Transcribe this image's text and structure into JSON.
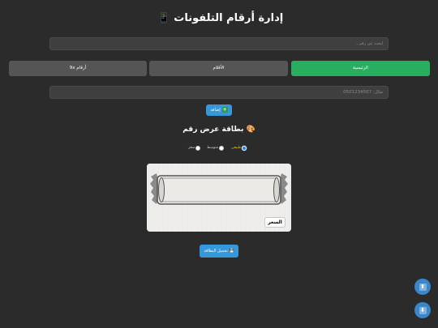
{
  "header": {
    "title": "إدارة أرقام التلفونات",
    "icon": "📱"
  },
  "search": {
    "placeholder": "ابحث عن رقم..."
  },
  "tabs": [
    {
      "label": "الرئيسية",
      "active": true
    },
    {
      "label": "الأقلام",
      "active": false
    },
    {
      "label": "أرقام 9x",
      "active": false
    }
  ],
  "phone_input": {
    "placeholder": "مثال: 0501234567"
  },
  "add_button": {
    "label": "إضافة",
    "icon": "➕"
  },
  "card_section": {
    "title": "بطاقة عرض رقم",
    "icon": "🎨",
    "options": [
      {
        "label": "طبيعي",
        "checked": true
      },
      {
        "label": "متوسط",
        "checked": false
      },
      {
        "label": "سعر",
        "checked": false
      }
    ],
    "price_label": "السعر"
  },
  "download_button": {
    "label": "تحميل البطاقة",
    "icon": "💾"
  },
  "fab": {
    "up_icon": "⬆",
    "down_icon": "⬇"
  },
  "colors": {
    "background": "#2b2b2b",
    "active_tab": "#27ae60",
    "button": "#3498db",
    "selected_option": "#f1c40f"
  }
}
